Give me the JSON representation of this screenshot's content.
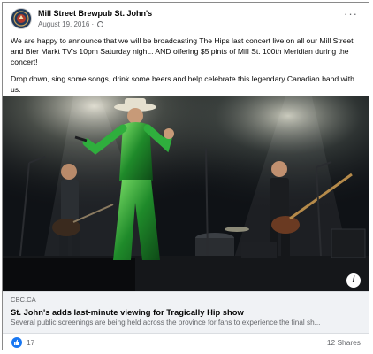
{
  "post": {
    "page_name": "Mill Street Brewpub St. John's",
    "date": "August 19, 2016",
    "separator": "·",
    "paragraphs": [
      "We are happy to announce that we will be broadcasting The Hips last concert live on all our Mill Street and Bier Markt TV's 10pm Saturday night.. AND offering $5 pints of Mill St. 100th Meridian during the concert!",
      "Drop down, sing some songs, drink some beers and help celebrate this legendary Canadian band with us."
    ],
    "more_icon": "ellipsis-icon",
    "privacy_icon": "globe-icon"
  },
  "link_preview": {
    "domain": "CBC.CA",
    "headline": "St. John's adds last-minute viewing for Tragically Hip show",
    "description": "Several public screenings are being held across the province for fans to experience the final sh...",
    "info_icon": "i"
  },
  "reactions": {
    "like_count": "17",
    "shares": "12 Shares",
    "like_icon": "thumbs-up-icon"
  },
  "colors": {
    "like_blue": "#1877f2",
    "link_card_bg": "#f0f2f5",
    "secondary_text": "#65676b"
  }
}
